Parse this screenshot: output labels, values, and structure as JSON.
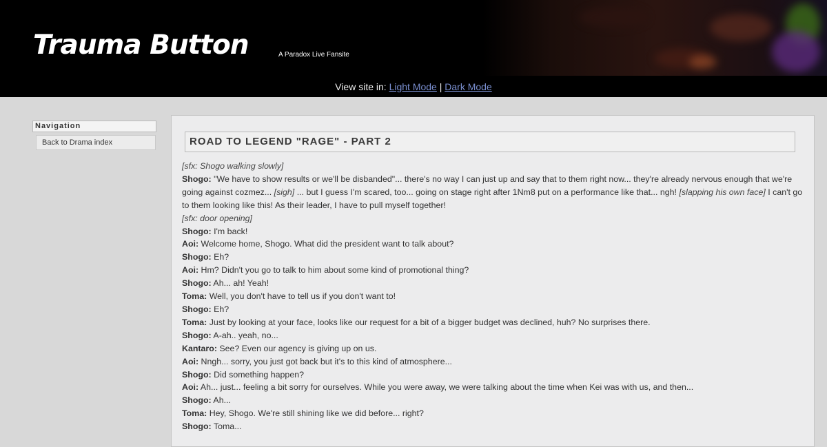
{
  "site": {
    "title": "Trauma Button",
    "tagline": "A Paradox Live Fansite"
  },
  "mode_bar": {
    "prefix": "View site in:",
    "light": "Light Mode",
    "separator": "|",
    "dark": "Dark Mode"
  },
  "nav": {
    "title": "Navigation",
    "items": [
      {
        "label": "Back to Drama index"
      }
    ]
  },
  "page": {
    "title": "ROAD TO LEGEND \"RAGE\" - PART 2"
  },
  "script": {
    "l0": {
      "sfx": "[sfx: Shogo walking slowly]"
    },
    "l1": {
      "speaker": "Shogo:",
      "a": " \"We have to show results or we'll be disbanded\"... there's no way I can just up and say that to them right now... they're already nervous enough that we're going against cozmez... ",
      "b": "[sigh]",
      "c": " ... but I guess I'm scared, too... going on stage right after 1Nm8 put on a performance like that... ngh! ",
      "d": "[slapping his own face]",
      "e": " I can't go to them looking like this! As their leader, I have to pull myself together!"
    },
    "l2": {
      "sfx": "[sfx: door opening]"
    },
    "l3": {
      "speaker": "Shogo:",
      "text": " I'm back!"
    },
    "l4": {
      "speaker": "Aoi:",
      "text": " Welcome home, Shogo. What did the president want to talk about?"
    },
    "l5": {
      "speaker": "Shogo:",
      "text": " Eh?"
    },
    "l6": {
      "speaker": "Aoi:",
      "text": " Hm? Didn't you go to talk to him about some kind of promotional thing?"
    },
    "l7": {
      "speaker": "Shogo:",
      "text": " Ah... ah! Yeah!"
    },
    "l8": {
      "speaker": "Toma:",
      "text": " Well, you don't have to tell us if you don't want to!"
    },
    "l9": {
      "speaker": "Shogo:",
      "text": " Eh?"
    },
    "l10": {
      "speaker": "Toma:",
      "text": " Just by looking at your face, looks like our request for a bit of a bigger budget was declined, huh? No surprises there."
    },
    "l11": {
      "speaker": "Shogo:",
      "text": " A-ah.. yeah, no..."
    },
    "l12": {
      "speaker": "Kantaro:",
      "text": " See? Even our agency is giving up on us."
    },
    "l13": {
      "speaker": "Aoi:",
      "text": " Nngh... sorry, you just got back but it's to this kind of atmosphere..."
    },
    "l14": {
      "speaker": "Shogo:",
      "text": " Did something happen?"
    },
    "l15": {
      "speaker": "Aoi:",
      "text": " Ah... just... feeling a bit sorry for ourselves. While you were away, we were talking about the time when Kei was with us, and then..."
    },
    "l16": {
      "speaker": "Shogo:",
      "text": " Ah..."
    },
    "l17": {
      "speaker": "Toma:",
      "text": " Hey, Shogo. We're still shining like we did before... right?"
    },
    "l18": {
      "speaker": "Shogo:",
      "text": " Toma..."
    }
  }
}
